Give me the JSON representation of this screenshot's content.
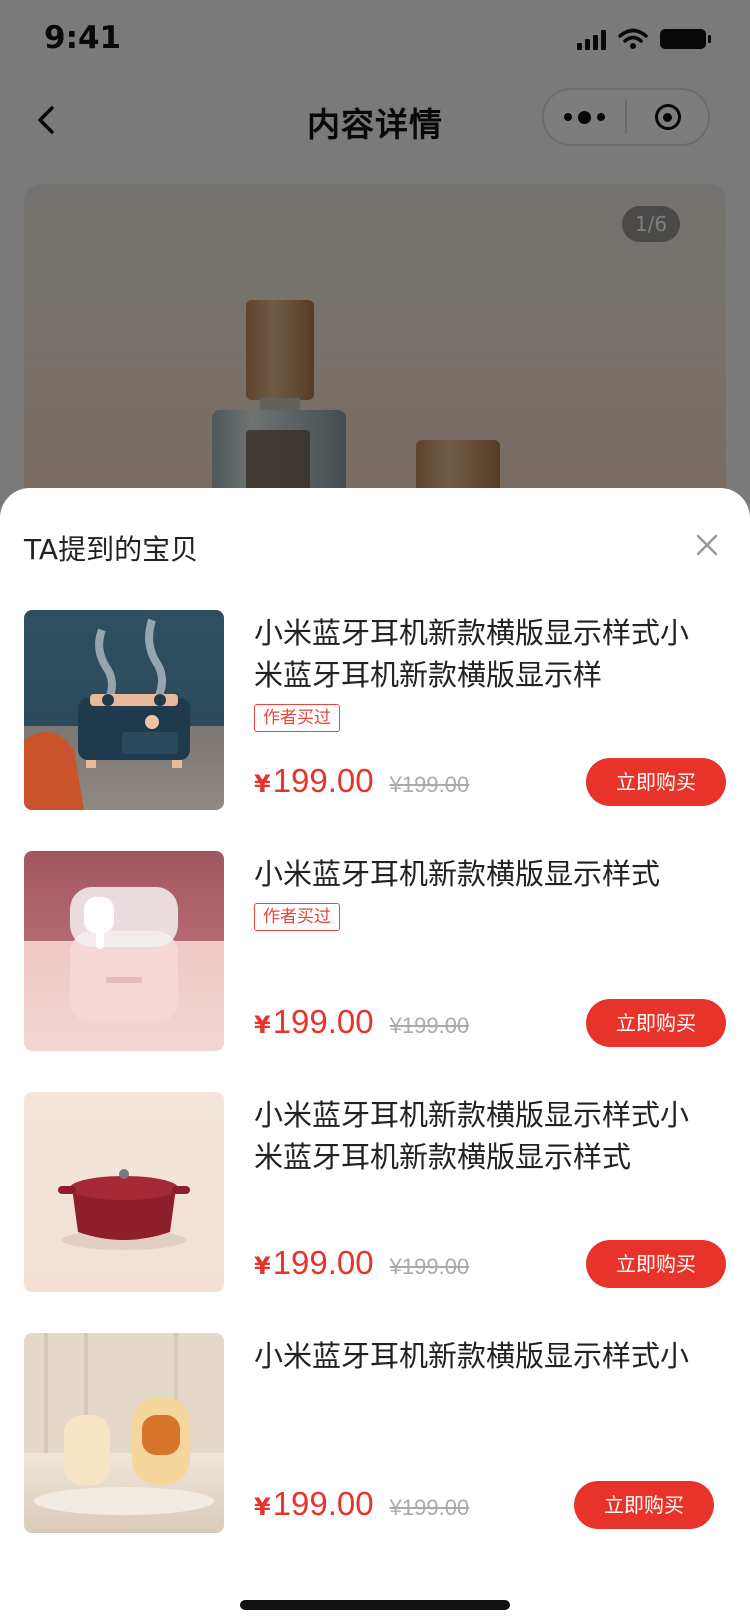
{
  "status": {
    "time": "9:41"
  },
  "nav": {
    "title": "内容详情"
  },
  "hero": {
    "counter": "1/6"
  },
  "sheet": {
    "title": "TA提到的宝贝",
    "products": [
      {
        "name": "小米蓝牙耳机新款横版显示样式小米蓝牙耳机新款横版显示样",
        "tag": "作者买过",
        "currency": "¥",
        "price": "199.00",
        "old_price": "¥199.00",
        "buy_label": "立即购买",
        "thumb": "humidifier"
      },
      {
        "name": "小米蓝牙耳机新款横版显示样式",
        "tag": "作者买过",
        "currency": "¥",
        "price": "199.00",
        "old_price": "¥199.00",
        "buy_label": "立即购买",
        "thumb": "earbuds-case"
      },
      {
        "name": "小米蓝牙耳机新款横版显示样式小米蓝牙耳机新款横版显示样式",
        "currency": "¥",
        "price": "199.00",
        "old_price": "¥199.00",
        "buy_label": "立即购买",
        "thumb": "red-pot"
      },
      {
        "name": "小米蓝牙耳机新款横版显示样式小",
        "currency": "¥",
        "price": "199.00",
        "old_price": "¥199.00",
        "buy_label": "立即购买",
        "thumb": "hand-warmers"
      }
    ]
  },
  "colors": {
    "accent": "#e8332a",
    "tag": "#e8453c",
    "overlay": "rgba(0,0,0,0.5)"
  }
}
